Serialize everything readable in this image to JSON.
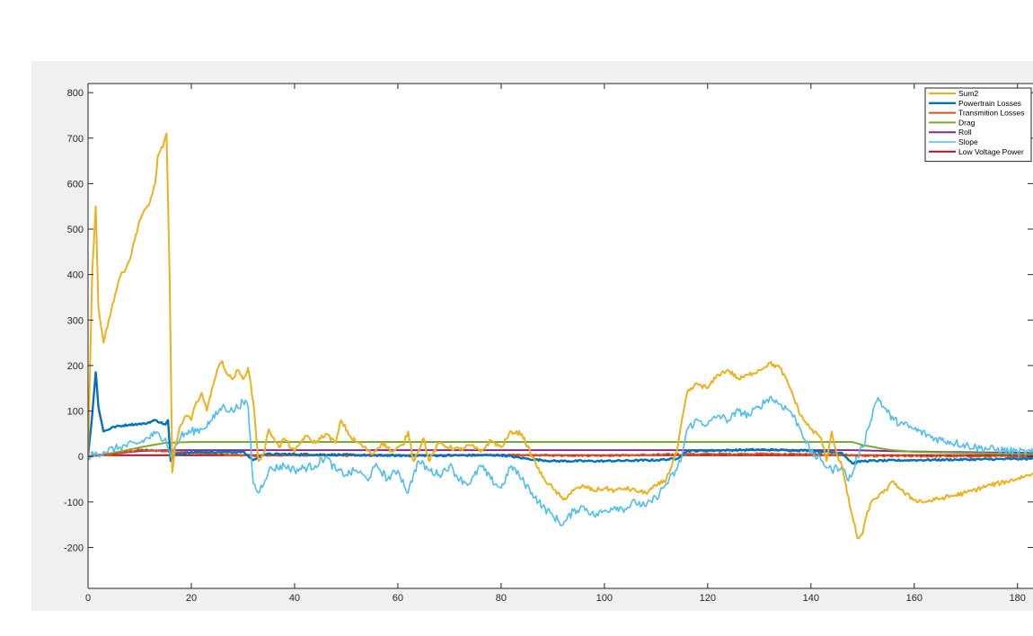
{
  "chart_data": {
    "type": "line",
    "title": "",
    "xlabel": "",
    "ylabel": "",
    "xlim": [
      0,
      183
    ],
    "ylim": [
      -290,
      820
    ],
    "xticks": [
      0,
      20,
      40,
      60,
      80,
      100,
      120,
      140,
      160,
      180
    ],
    "yticks": [
      -200,
      -100,
      0,
      100,
      200,
      300,
      400,
      500,
      600,
      700,
      800
    ],
    "grid": false,
    "legend_position": "top-right",
    "series": [
      {
        "name": "Sum2",
        "color": "#EDB120",
        "width": 2,
        "noise": 5,
        "points": [
          [
            0,
            0
          ],
          [
            0.8,
            400
          ],
          [
            1.5,
            550
          ],
          [
            2,
            330
          ],
          [
            3,
            250
          ],
          [
            4,
            300
          ],
          [
            6,
            390
          ],
          [
            8,
            430
          ],
          [
            10,
            520
          ],
          [
            12,
            560
          ],
          [
            13,
            600
          ],
          [
            13.5,
            660
          ],
          [
            14.5,
            680
          ],
          [
            15.2,
            710
          ],
          [
            15.8,
            400
          ],
          [
            16.3,
            -35
          ],
          [
            17,
            30
          ],
          [
            18,
            70
          ],
          [
            19,
            90
          ],
          [
            20,
            80
          ],
          [
            21,
            120
          ],
          [
            22,
            140
          ],
          [
            23,
            100
          ],
          [
            24,
            150
          ],
          [
            25,
            190
          ],
          [
            26,
            210
          ],
          [
            27,
            180
          ],
          [
            28,
            170
          ],
          [
            29,
            190
          ],
          [
            30,
            170
          ],
          [
            31,
            195
          ],
          [
            32,
            120
          ],
          [
            33,
            -10
          ],
          [
            34,
            5
          ],
          [
            35,
            60
          ],
          [
            36,
            40
          ],
          [
            37,
            20
          ],
          [
            38,
            40
          ],
          [
            40,
            10
          ],
          [
            42,
            45
          ],
          [
            44,
            30
          ],
          [
            46,
            50
          ],
          [
            48,
            30
          ],
          [
            49,
            80
          ],
          [
            51,
            40
          ],
          [
            53,
            25
          ],
          [
            55,
            5
          ],
          [
            57,
            30
          ],
          [
            59,
            10
          ],
          [
            61,
            25
          ],
          [
            62,
            55
          ],
          [
            63,
            -10
          ],
          [
            65,
            40
          ],
          [
            66,
            -10
          ],
          [
            68,
            30
          ],
          [
            70,
            20
          ],
          [
            72,
            15
          ],
          [
            74,
            25
          ],
          [
            76,
            10
          ],
          [
            78,
            35
          ],
          [
            80,
            20
          ],
          [
            82,
            55
          ],
          [
            84,
            50
          ],
          [
            86,
            0
          ],
          [
            88,
            -45
          ],
          [
            90,
            -70
          ],
          [
            92,
            -95
          ],
          [
            94,
            -75
          ],
          [
            96,
            -65
          ],
          [
            98,
            -75
          ],
          [
            100,
            -70
          ],
          [
            102,
            -75
          ],
          [
            104,
            -70
          ],
          [
            106,
            -75
          ],
          [
            108,
            -80
          ],
          [
            110,
            -65
          ],
          [
            112,
            -50
          ],
          [
            114,
            10
          ],
          [
            116,
            140
          ],
          [
            118,
            160
          ],
          [
            120,
            150
          ],
          [
            122,
            180
          ],
          [
            124,
            190
          ],
          [
            126,
            170
          ],
          [
            128,
            180
          ],
          [
            130,
            190
          ],
          [
            132,
            205
          ],
          [
            134,
            195
          ],
          [
            136,
            150
          ],
          [
            138,
            90
          ],
          [
            140,
            60
          ],
          [
            142,
            40
          ],
          [
            143,
            -10
          ],
          [
            144,
            55
          ],
          [
            145,
            5
          ],
          [
            146,
            -20
          ],
          [
            147,
            -80
          ],
          [
            148,
            -130
          ],
          [
            149,
            -180
          ],
          [
            150,
            -170
          ],
          [
            151,
            -120
          ],
          [
            152,
            -95
          ],
          [
            154,
            -80
          ],
          [
            156,
            -55
          ],
          [
            158,
            -80
          ],
          [
            160,
            -95
          ],
          [
            162,
            -100
          ],
          [
            164,
            -95
          ],
          [
            166,
            -90
          ],
          [
            170,
            -80
          ],
          [
            174,
            -65
          ],
          [
            178,
            -55
          ],
          [
            183,
            -38
          ]
        ]
      },
      {
        "name": "Powertrain Losses",
        "color": "#0072BD",
        "width": 2.4,
        "noise": 2,
        "points": [
          [
            0,
            0
          ],
          [
            0.8,
            90
          ],
          [
            1.5,
            185
          ],
          [
            2,
            110
          ],
          [
            3,
            55
          ],
          [
            5,
            65
          ],
          [
            8,
            70
          ],
          [
            11,
            72
          ],
          [
            13,
            80
          ],
          [
            15,
            70
          ],
          [
            15.5,
            80
          ],
          [
            16,
            -10
          ],
          [
            17,
            5
          ],
          [
            20,
            10
          ],
          [
            30,
            10
          ],
          [
            32,
            -8
          ],
          [
            34,
            5
          ],
          [
            40,
            5
          ],
          [
            60,
            2
          ],
          [
            80,
            3
          ],
          [
            85,
            -5
          ],
          [
            90,
            -10
          ],
          [
            100,
            -10
          ],
          [
            110,
            -8
          ],
          [
            114,
            -5
          ],
          [
            116,
            12
          ],
          [
            130,
            15
          ],
          [
            140,
            13
          ],
          [
            146,
            8
          ],
          [
            148,
            -15
          ],
          [
            150,
            -10
          ],
          [
            160,
            -8
          ],
          [
            183,
            -5
          ]
        ]
      },
      {
        "name": "Transmition Losses",
        "color": "#D95319",
        "width": 2,
        "noise": 2,
        "points": [
          [
            0,
            0
          ],
          [
            2,
            3
          ],
          [
            5,
            5
          ],
          [
            10,
            15
          ],
          [
            20,
            8
          ],
          [
            32,
            2
          ],
          [
            40,
            3
          ],
          [
            60,
            2
          ],
          [
            80,
            3
          ],
          [
            100,
            2
          ],
          [
            116,
            5
          ],
          [
            130,
            6
          ],
          [
            146,
            4
          ],
          [
            150,
            1
          ],
          [
            183,
            0
          ]
        ]
      },
      {
        "name": "Drag",
        "color": "#77AC30",
        "width": 2,
        "noise": 0,
        "points": [
          [
            0,
            0
          ],
          [
            5,
            8
          ],
          [
            10,
            20
          ],
          [
            15,
            30
          ],
          [
            20,
            32
          ],
          [
            140,
            32
          ],
          [
            148,
            32
          ],
          [
            150,
            25
          ],
          [
            155,
            15
          ],
          [
            160,
            10
          ],
          [
            183,
            5
          ]
        ]
      },
      {
        "name": "Roll",
        "color": "#7E2F8E",
        "width": 2,
        "noise": 0,
        "points": [
          [
            0,
            0
          ],
          [
            5,
            6
          ],
          [
            10,
            12
          ],
          [
            15,
            14
          ],
          [
            148,
            14
          ],
          [
            155,
            12
          ],
          [
            165,
            10
          ],
          [
            183,
            8
          ]
        ]
      },
      {
        "name": "Slope",
        "color": "#4DBEEE",
        "width": 1.6,
        "noise": 9,
        "points": [
          [
            0,
            0
          ],
          [
            3,
            10
          ],
          [
            6,
            20
          ],
          [
            10,
            30
          ],
          [
            13,
            50
          ],
          [
            15,
            40
          ],
          [
            16,
            0
          ],
          [
            18,
            45
          ],
          [
            20,
            55
          ],
          [
            22,
            60
          ],
          [
            24,
            80
          ],
          [
            26,
            110
          ],
          [
            28,
            100
          ],
          [
            30,
            120
          ],
          [
            31,
            110
          ],
          [
            32,
            -60
          ],
          [
            33,
            -80
          ],
          [
            35,
            -30
          ],
          [
            38,
            -20
          ],
          [
            40,
            -30
          ],
          [
            44,
            -20
          ],
          [
            46,
            0
          ],
          [
            48,
            -30
          ],
          [
            50,
            -40
          ],
          [
            52,
            -30
          ],
          [
            54,
            -50
          ],
          [
            56,
            -20
          ],
          [
            58,
            -50
          ],
          [
            60,
            -30
          ],
          [
            62,
            -80
          ],
          [
            63,
            -40
          ],
          [
            64,
            -10
          ],
          [
            66,
            -30
          ],
          [
            68,
            -40
          ],
          [
            70,
            -20
          ],
          [
            72,
            -50
          ],
          [
            74,
            -60
          ],
          [
            76,
            -20
          ],
          [
            78,
            -50
          ],
          [
            80,
            -70
          ],
          [
            82,
            -20
          ],
          [
            84,
            -50
          ],
          [
            86,
            -80
          ],
          [
            88,
            -110
          ],
          [
            90,
            -130
          ],
          [
            92,
            -150
          ],
          [
            94,
            -120
          ],
          [
            96,
            -110
          ],
          [
            98,
            -130
          ],
          [
            100,
            -120
          ],
          [
            102,
            -110
          ],
          [
            104,
            -115
          ],
          [
            106,
            -100
          ],
          [
            108,
            -110
          ],
          [
            110,
            -90
          ],
          [
            112,
            -60
          ],
          [
            114,
            -30
          ],
          [
            115,
            0
          ],
          [
            116,
            60
          ],
          [
            118,
            80
          ],
          [
            120,
            70
          ],
          [
            122,
            90
          ],
          [
            124,
            80
          ],
          [
            126,
            100
          ],
          [
            128,
            90
          ],
          [
            130,
            110
          ],
          [
            132,
            130
          ],
          [
            134,
            115
          ],
          [
            136,
            100
          ],
          [
            138,
            60
          ],
          [
            140,
            10
          ],
          [
            142,
            -10
          ],
          [
            144,
            -30
          ],
          [
            146,
            -20
          ],
          [
            147,
            -50
          ],
          [
            148,
            -40
          ],
          [
            149,
            0
          ],
          [
            150,
            20
          ],
          [
            151,
            60
          ],
          [
            152,
            100
          ],
          [
            153,
            130
          ],
          [
            154,
            110
          ],
          [
            156,
            80
          ],
          [
            158,
            70
          ],
          [
            160,
            60
          ],
          [
            164,
            40
          ],
          [
            168,
            30
          ],
          [
            172,
            20
          ],
          [
            176,
            15
          ],
          [
            180,
            10
          ],
          [
            183,
            8
          ]
        ]
      },
      {
        "name": "Low Voltage Power",
        "color": "#A2142F",
        "width": 2,
        "noise": 0,
        "points": [
          [
            0,
            0
          ],
          [
            2,
            3
          ],
          [
            183,
            3
          ]
        ]
      }
    ]
  }
}
